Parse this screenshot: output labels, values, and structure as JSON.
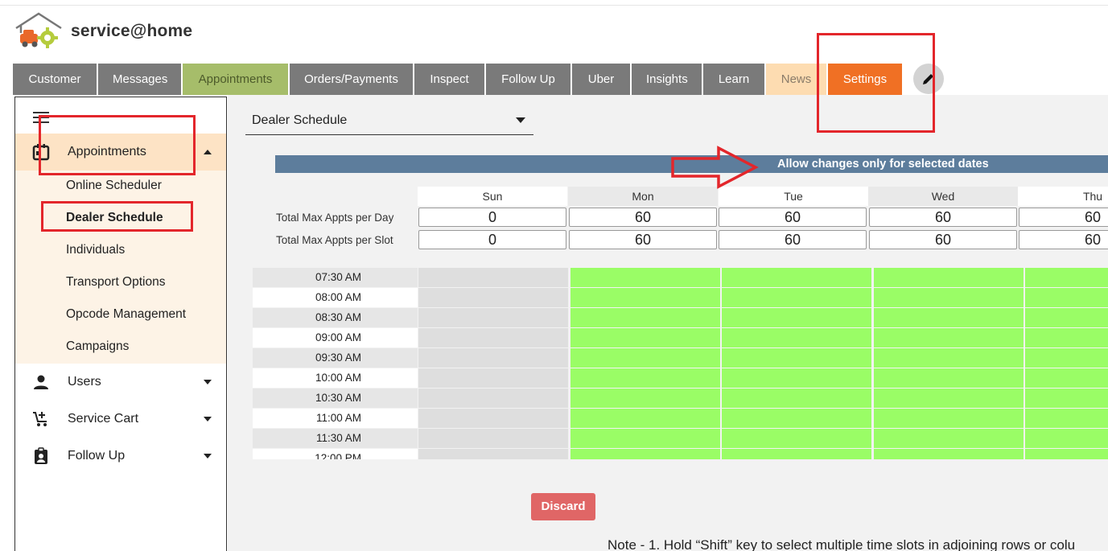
{
  "app": {
    "brand": "service@home"
  },
  "nav": {
    "tabs": [
      {
        "label": "Customer"
      },
      {
        "label": "Messages"
      },
      {
        "label": "Appointments"
      },
      {
        "label": "Orders/Payments"
      },
      {
        "label": "Inspect"
      },
      {
        "label": "Follow Up"
      },
      {
        "label": "Uber"
      },
      {
        "label": "Insights"
      },
      {
        "label": "Learn"
      },
      {
        "label": "News"
      },
      {
        "label": "Settings"
      }
    ]
  },
  "sidebar": {
    "appointments": {
      "label": "Appointments"
    },
    "submenu": [
      {
        "label": "Online Scheduler"
      },
      {
        "label": "Dealer Schedule"
      },
      {
        "label": "Individuals"
      },
      {
        "label": "Transport Options"
      },
      {
        "label": "Opcode Management"
      },
      {
        "label": "Campaigns"
      }
    ],
    "users": {
      "label": "Users"
    },
    "service_cart": {
      "label": "Service Cart"
    },
    "follow_up": {
      "label": "Follow Up"
    }
  },
  "main": {
    "dropdown": {
      "value": "Dealer Schedule"
    },
    "banner": "Allow changes only for selected dates",
    "days": [
      "Sun",
      "Mon",
      "Tue",
      "Wed",
      "Thu"
    ],
    "row_labels": {
      "per_day": "Total Max Appts per Day",
      "per_slot": "Total Max Appts per Slot"
    },
    "per_day": [
      "0",
      "60",
      "60",
      "60",
      "60"
    ],
    "per_slot": [
      "0",
      "60",
      "60",
      "60",
      "60"
    ],
    "times": [
      "07:30 AM",
      "08:00 AM",
      "08:30 AM",
      "09:00 AM",
      "09:30 AM",
      "10:00 AM",
      "10:30 AM",
      "11:00 AM",
      "11:30 AM",
      "12:00 PM"
    ],
    "slot_status_by_day": [
      "closed",
      "open",
      "open",
      "open",
      "open"
    ],
    "discard_label": "Discard",
    "note": "Note - 1. Hold “Shift” key to select multiple time slots in adjoining rows or colu"
  },
  "colors": {
    "tab_gray": "#7a7a7a",
    "tab_appointments": "#a6bd6a",
    "tab_news": "#fddcb1",
    "tab_settings": "#f07024",
    "banner": "#5d7d9c",
    "slot_open": "#9afd66",
    "slot_closed": "#dedede",
    "discard": "#e06666",
    "annotation": "#e3262b"
  }
}
